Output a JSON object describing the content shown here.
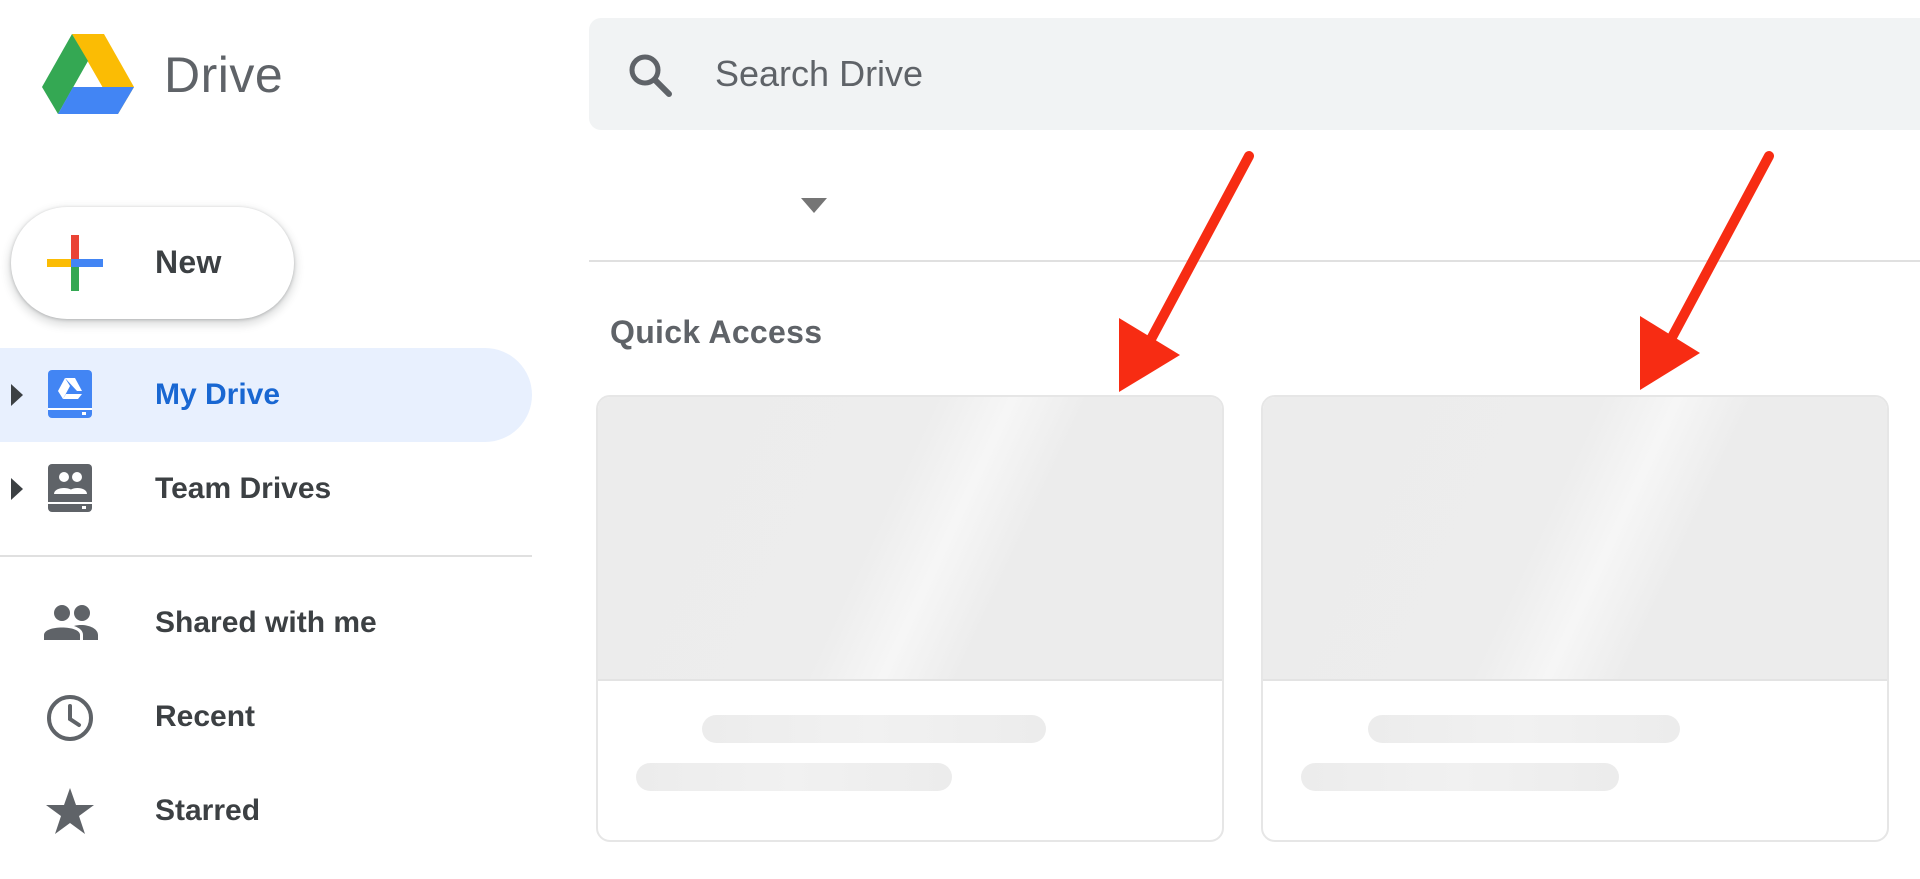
{
  "app": {
    "name": "Drive"
  },
  "new_button": {
    "label": "New"
  },
  "sidebar": {
    "items": [
      {
        "label": "My Drive",
        "icon": "my-drive-icon",
        "active": true,
        "expandable": true
      },
      {
        "label": "Team Drives",
        "icon": "team-drives-icon",
        "active": false,
        "expandable": true
      },
      {
        "label": "Shared with me",
        "icon": "shared-with-me-icon",
        "active": false,
        "expandable": false
      },
      {
        "label": "Recent",
        "icon": "clock-icon",
        "active": false,
        "expandable": false
      },
      {
        "label": "Starred",
        "icon": "star-icon",
        "active": false,
        "expandable": false
      }
    ]
  },
  "search": {
    "placeholder": "Search Drive",
    "value": ""
  },
  "quick_access": {
    "title": "Quick Access",
    "cards": [
      {
        "state": "loading"
      },
      {
        "state": "loading"
      }
    ]
  },
  "colors": {
    "active_bg": "#e8f0fe",
    "active_text": "#1967d2",
    "annotation_arrow": "#f72c13",
    "google_blue": "#4285f4",
    "google_red": "#ea4335",
    "google_yellow": "#fbbc04",
    "google_green": "#34a853"
  }
}
